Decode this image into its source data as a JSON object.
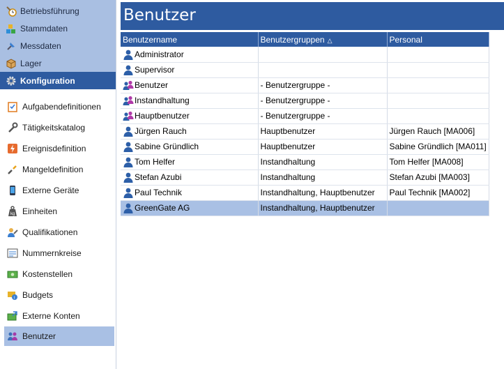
{
  "modules": [
    {
      "label": "Betriebsführung",
      "icon": "clock-wrench-icon"
    },
    {
      "label": "Stammdaten",
      "icon": "blocks-icon"
    },
    {
      "label": "Messdaten",
      "icon": "pin-icon"
    },
    {
      "label": "Lager",
      "icon": "box-icon"
    },
    {
      "label": "Konfiguration",
      "icon": "gear-icon",
      "active": true
    }
  ],
  "config_menu": [
    {
      "label": "Aufgabendefinitionen",
      "icon": "checklist-icon"
    },
    {
      "label": "Tätigkeitskatalog",
      "icon": "wrench-icon"
    },
    {
      "label": "Ereignisdefinition",
      "icon": "lightning-icon"
    },
    {
      "label": "Mangeldefinition",
      "icon": "broken-wrench-icon"
    },
    {
      "label": "Externe Geräte",
      "icon": "phone-icon"
    },
    {
      "label": "Einheiten",
      "icon": "weight-icon"
    },
    {
      "label": "Qualifikationen",
      "icon": "person-wrench-icon"
    },
    {
      "label": "Nummernkreise",
      "icon": "number-range-icon"
    },
    {
      "label": "Kostenstellen",
      "icon": "money-icon"
    },
    {
      "label": "Budgets",
      "icon": "budget-icon"
    },
    {
      "label": "Externe Konten",
      "icon": "external-accounts-icon"
    },
    {
      "label": "Benutzer",
      "icon": "users-icon",
      "selected": true
    }
  ],
  "page": {
    "title": "Benutzer"
  },
  "table": {
    "columns": [
      "Benutzername",
      "Benutzergruppen",
      "Personal"
    ],
    "sort_indicator": "△",
    "rows": [
      {
        "name": "Administrator",
        "groups": "",
        "personal": "",
        "type": "user"
      },
      {
        "name": "Supervisor",
        "groups": "",
        "personal": "",
        "type": "user"
      },
      {
        "name": "Benutzer",
        "groups": "- Benutzergruppe -",
        "personal": "",
        "type": "group"
      },
      {
        "name": "Instandhaltung",
        "groups": "- Benutzergruppe -",
        "personal": "",
        "type": "group"
      },
      {
        "name": "Hauptbenutzer",
        "groups": "- Benutzergruppe -",
        "personal": "",
        "type": "group"
      },
      {
        "name": "Jürgen Rauch",
        "groups": "Hauptbenutzer",
        "personal": "Jürgen Rauch [MA006]",
        "type": "user"
      },
      {
        "name": "Sabine Gründlich",
        "groups": "Hauptbenutzer",
        "personal": "Sabine Gründlich [MA011]",
        "type": "user"
      },
      {
        "name": "Tom Helfer",
        "groups": "Instandhaltung",
        "personal": "Tom Helfer [MA008]",
        "type": "user"
      },
      {
        "name": "Stefan Azubi",
        "groups": "Instandhaltung",
        "personal": "Stefan Azubi [MA003]",
        "type": "user"
      },
      {
        "name": "Paul Technik",
        "groups": "Instandhaltung, Hauptbenutzer",
        "personal": "Paul Technik [MA002]",
        "type": "user"
      },
      {
        "name": "GreenGate AG",
        "groups": "Instandhaltung, Hauptbenutzer",
        "personal": "",
        "type": "user",
        "selected": true
      }
    ]
  },
  "colors": {
    "accent": "#2e5ba0",
    "module_bg": "#a9bfe2",
    "selection": "#a9c0e4"
  }
}
